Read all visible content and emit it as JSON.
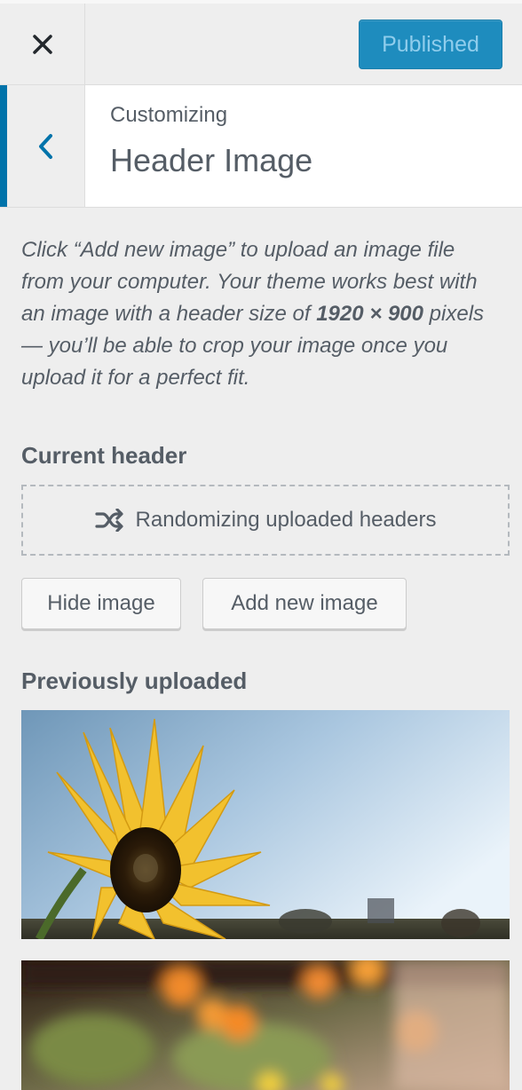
{
  "topbar": {
    "close_label": "Close",
    "publish_label": "Published"
  },
  "section": {
    "breadcrumb": "Customizing",
    "title": "Header Image"
  },
  "description": {
    "part1": "Click “Add new image” to upload an image file from your computer. Your theme works best with an image with a header size of ",
    "size": "1920 × 900",
    "part2": " pixels — you’ll be able to crop your image once you upload it for a perfect fit."
  },
  "current_header": {
    "heading": "Current header",
    "status": "Randomizing uploaded headers"
  },
  "buttons": {
    "hide": "Hide image",
    "add": "Add new image"
  },
  "previously": {
    "heading": "Previously uploaded",
    "images": [
      {
        "icon": "sunflower-photo"
      },
      {
        "icon": "blurred-flowers-photo"
      }
    ]
  },
  "colors": {
    "accent": "#0073aa",
    "publish_bg": "#1e8cbe",
    "background": "#eeeeee"
  }
}
